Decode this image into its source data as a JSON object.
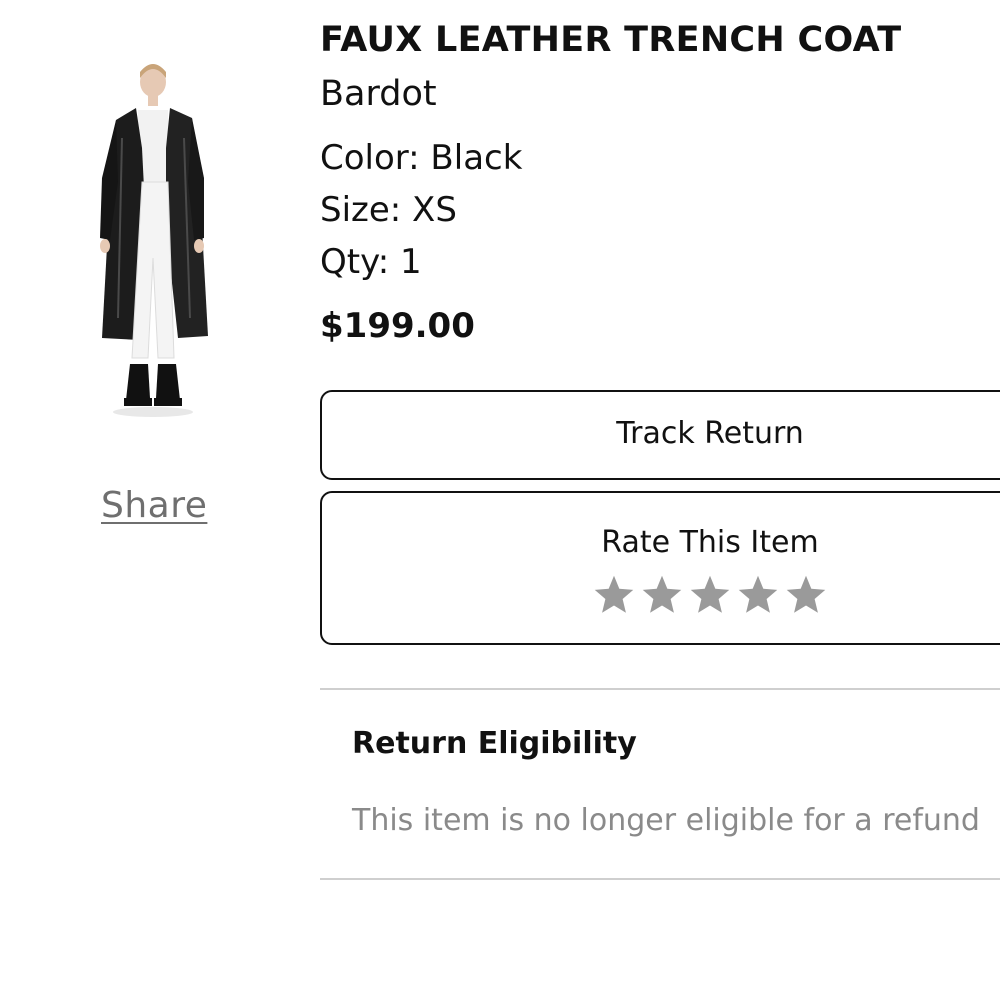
{
  "product": {
    "title": "FAUX LEATHER TRENCH COAT",
    "brand": "Bardot",
    "color_label": "Color: Black",
    "size_label": "Size: XS",
    "qty_label": "Qty: 1",
    "price": "$199.00",
    "image_icon": "product-photo-trench-coat"
  },
  "share": {
    "label": "Share"
  },
  "actions": {
    "track_return_label": "Track Return",
    "rate_item_label": "Rate This Item",
    "rating": {
      "max_stars": 5,
      "selected": 0,
      "star_color": "#9a9a9a"
    }
  },
  "eligibility": {
    "title": "Return Eligibility",
    "message": "This item is no longer eligible for a refund"
  }
}
